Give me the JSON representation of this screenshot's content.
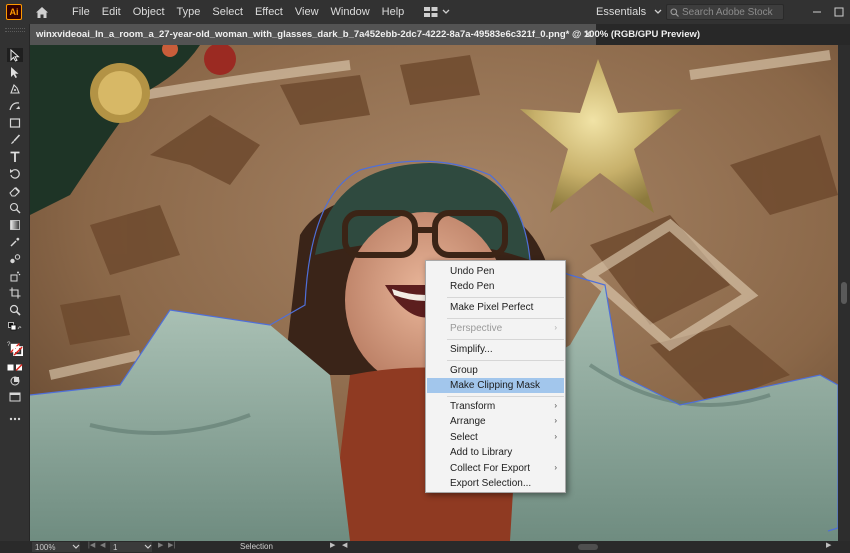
{
  "app": {
    "logo": "Ai"
  },
  "menu": [
    "File",
    "Edit",
    "Object",
    "Type",
    "Select",
    "Effect",
    "View",
    "Window",
    "Help"
  ],
  "workspace": {
    "label": "Essentials"
  },
  "search": {
    "placeholder": "Search Adobe Stock"
  },
  "document": {
    "tab_title": "winxvideoai_In_a_room_a_27-year-old_woman_with_glasses_dark_b_7a452ebb-2dc7-4222-8a7a-49583e6c321f_0.png* @ 100% (RGB/GPU Preview)",
    "close": "✕"
  },
  "status": {
    "zoom": "100%",
    "page": "1",
    "tool": "Selection"
  },
  "context_menu": {
    "undo": "Undo Pen",
    "redo": "Redo Pen",
    "pixel_perfect": "Make Pixel Perfect",
    "perspective": "Perspective",
    "simplify": "Simplify...",
    "group": "Group",
    "clipping_mask": "Make Clipping Mask",
    "transform": "Transform",
    "arrange": "Arrange",
    "select": "Select",
    "add_to_library": "Add to Library",
    "collect_for_export": "Collect For Export",
    "export_selection": "Export Selection...",
    "submenu_arrow": "›"
  },
  "colors": {
    "highlight": "#a2c6ec",
    "path_outline": "#4f6fd8",
    "logo_accent": "#ff9a00"
  }
}
